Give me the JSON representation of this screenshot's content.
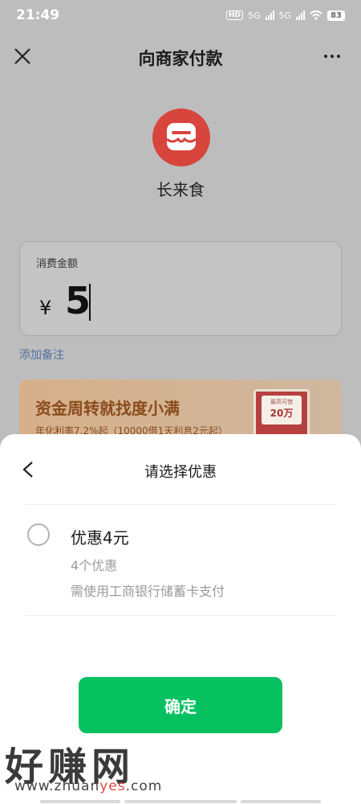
{
  "status": {
    "time": "21:49",
    "hd": "HD",
    "sim1": "5G",
    "sim2": "5G",
    "battery": "83"
  },
  "nav": {
    "title": "向商家付款",
    "close_icon": "close-icon",
    "more_icon": "more-icon"
  },
  "merchant": {
    "name": "长来食",
    "logo_color": "#d8453d"
  },
  "amount": {
    "label": "消费金额",
    "currency": "¥",
    "value": "5"
  },
  "note_link": "添加备注",
  "promo": {
    "title": "资金周转就找度小满",
    "subtitle": "年化利率7.2%起（10000借1天利息2元起）",
    "card_top": "最高可借",
    "card_amount": "20万"
  },
  "sheet": {
    "title": "请选择优惠",
    "coupon": {
      "title": "优惠4元",
      "count": "4个优惠",
      "condition": "需使用工商银行储蓄卡支付",
      "selected": false
    },
    "confirm_label": "确定"
  },
  "watermark": {
    "main": "好赚网",
    "url_prefix": "www.zhuan",
    "url_highlight": "yes",
    "url_suffix": ".com"
  },
  "colors": {
    "accent_green": "#07c160",
    "link_blue": "#506fa0",
    "promo_brown": "#8a4c1c"
  }
}
